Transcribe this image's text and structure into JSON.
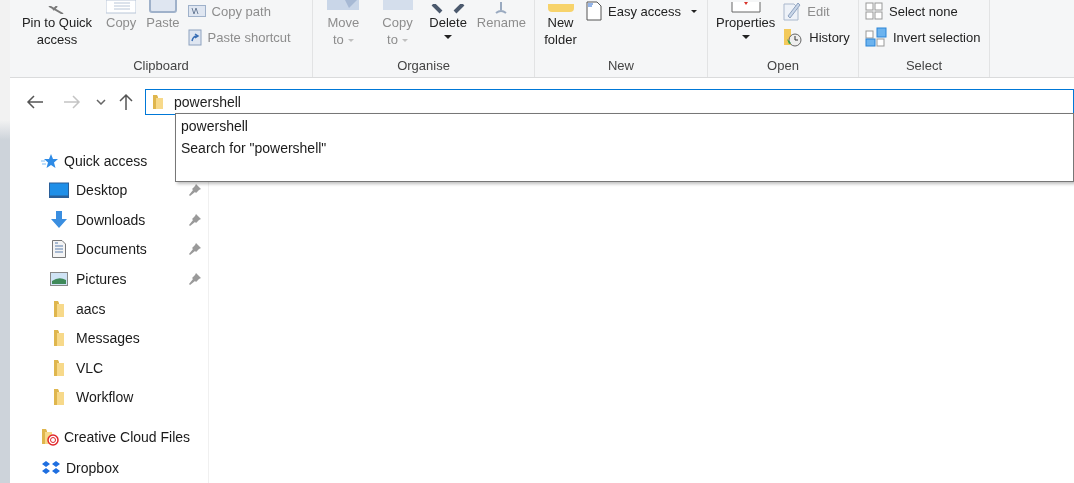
{
  "ribbon": {
    "groups": [
      {
        "label": "Clipboard",
        "items": [
          {
            "kind": "large",
            "label": "Pin to Quick access",
            "disabled": false
          },
          {
            "kind": "large",
            "label": "Copy",
            "disabled": true
          },
          {
            "kind": "large",
            "label": "Paste",
            "disabled": true
          },
          {
            "kind": "small",
            "label": "Copy path",
            "disabled": true
          },
          {
            "kind": "small",
            "label": "Paste shortcut",
            "disabled": true
          }
        ]
      },
      {
        "label": "Organise",
        "items": [
          {
            "kind": "large",
            "label": "Move to",
            "disabled": true,
            "dropdown": true
          },
          {
            "kind": "large",
            "label": "Copy to",
            "disabled": true,
            "dropdown": true
          },
          {
            "kind": "large",
            "label": "Delete",
            "disabled": false,
            "dropdown": true
          },
          {
            "kind": "large",
            "label": "Rename",
            "disabled": true
          }
        ]
      },
      {
        "label": "New",
        "items": [
          {
            "kind": "large",
            "label": "New folder",
            "disabled": false
          },
          {
            "kind": "small",
            "label": "Easy access",
            "disabled": false,
            "dropdown": true
          }
        ]
      },
      {
        "label": "Open",
        "items": [
          {
            "kind": "large",
            "label": "Properties",
            "disabled": false,
            "dropdown": true
          },
          {
            "kind": "small",
            "label": "Edit",
            "disabled": true
          },
          {
            "kind": "small",
            "label": "History",
            "disabled": false
          }
        ]
      },
      {
        "label": "Select",
        "items": [
          {
            "kind": "small",
            "label": "Select none",
            "disabled": false
          },
          {
            "kind": "small",
            "label": "Invert selection",
            "disabled": false
          }
        ]
      }
    ]
  },
  "address_bar": {
    "value": "powershell",
    "suggestions": [
      "powershell",
      "Search for \"powershell\""
    ]
  },
  "sidebar": {
    "items": [
      {
        "kind": "quick",
        "label": "Quick access",
        "children": [
          {
            "kind": "desktop",
            "label": "Desktop",
            "pinned": true
          },
          {
            "kind": "downloads",
            "label": "Downloads",
            "pinned": true
          },
          {
            "kind": "documents",
            "label": "Documents",
            "pinned": true
          },
          {
            "kind": "pictures",
            "label": "Pictures",
            "pinned": true
          },
          {
            "kind": "folder",
            "label": "aacs",
            "pinned": false
          },
          {
            "kind": "folder",
            "label": "Messages",
            "pinned": false
          },
          {
            "kind": "folder",
            "label": "VLC",
            "pinned": false
          },
          {
            "kind": "folder",
            "label": "Workflow",
            "pinned": false
          }
        ]
      },
      {
        "kind": "cloud",
        "label": "Creative Cloud Files"
      },
      {
        "kind": "dropbox",
        "label": "Dropbox"
      }
    ]
  }
}
